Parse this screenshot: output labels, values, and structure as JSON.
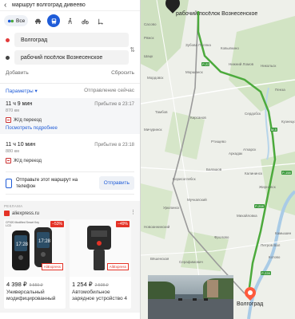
{
  "search": {
    "query": "маршрут волгоград дивеево"
  },
  "modes": {
    "all_label": "Все"
  },
  "points": {
    "from": "Волгоград",
    "to": "рабочий посёлок Вознесенское"
  },
  "links": {
    "add": "Добавить",
    "reset": "Сбросить"
  },
  "params": {
    "label": "Параметры",
    "caret": "▾",
    "departure": "Отправление сейчас"
  },
  "routes": [
    {
      "time": "11 ч 9 мин",
      "arrival": "Прибытие в 23:17",
      "distance": "870 км",
      "warning": "Ж/д переезд",
      "details": "Посмотреть подробнее"
    },
    {
      "time": "11 ч 10 мин",
      "arrival": "Прибытие в 23:18",
      "distance": "880 км",
      "warning": "Ж/д переезд"
    }
  ],
  "send": {
    "text": "Отправьте этот маршрут на телефон",
    "button": "Отправить"
  },
  "ad": {
    "label": "РЕКЛАМА",
    "source": "aliexpress.ru",
    "more": "⋮",
    "cards": [
      {
        "badge": "−53%",
        "tiny": "CF920 Modified Smart Key LCD",
        "tag": "AliExpress",
        "price": "4 398 ₽",
        "old_price": "9 559 ₽",
        "title": "Универсальный модифицированный"
      },
      {
        "badge": "−49%",
        "tag": "AliExpress",
        "price": "1 254 ₽",
        "old_price": "2 508 ₽",
        "title": "Автомобильное зарядное устройство 4"
      }
    ]
  },
  "map": {
    "start_town": "рабочий посёлок Вознесенское",
    "end_city": "Волгоград",
    "towns": [
      "Зубова Поляна",
      "Ковылкино",
      "Мордовск",
      "Моршанск",
      "Пенза",
      "Тамбов",
      "Кирсанов",
      "Сердобск",
      "Мичуринск",
      "Ртищево",
      "Борисоглебск",
      "Балашов",
      "Аркадак",
      "Калининск",
      "Жирновск",
      "Михайловка",
      "Урюпинск",
      "Фролово",
      "Серафимович",
      "Вёшенская",
      "Камышин",
      "Петров Вал",
      "Котово",
      "Новоаннинский",
      "Кузнецк",
      "Аткарск",
      "Шацк",
      "Ряжск",
      "Мучкапский",
      "Никольск",
      "Сасово",
      "Нижний Ломов"
    ],
    "road_badges": [
      "Р-22",
      "М-5",
      "Р-158",
      "Р-228",
      "Р-208"
    ]
  },
  "colors": {
    "accent": "#1e5bd8",
    "route_main": "#4caa3c",
    "route_alt": "#9a9a9a",
    "ad_red": "#e43226"
  }
}
